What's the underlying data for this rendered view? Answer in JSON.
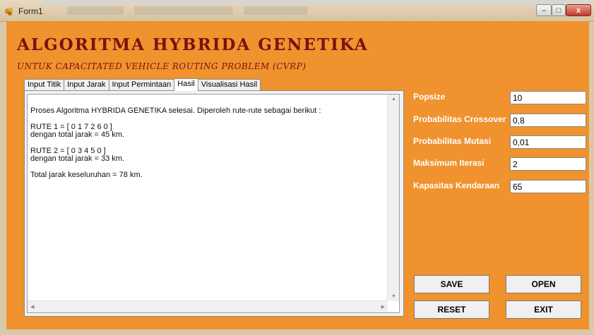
{
  "window": {
    "title": "Form1",
    "minimize": "–",
    "maximize": "□",
    "close": "x"
  },
  "header": {
    "title": "ALGORITMA HYBRIDA GENETIKA",
    "subtitle": "UNTUK CAPACITATED VEHICLE ROUTING PROBLEM (CVRP)"
  },
  "tabs": [
    {
      "label": "Input Titik"
    },
    {
      "label": "Input Jarak"
    },
    {
      "label": "Input Permintaan"
    },
    {
      "label": "Hasil"
    },
    {
      "label": "Visualisasi Hasil"
    }
  ],
  "active_tab": "Hasil",
  "result": {
    "line1": "Proses Algoritma HYBRIDA GENETIKA selesai. Diperoleh rute-rute sebagai berikut :",
    "route1": "RUTE 1 = [  0  1  7  2  6  0  ]",
    "route1_distance": "dengan total jarak = 45 km.",
    "route2": "RUTE 2 = [  0  3  4  5  0  ]",
    "route2_distance": "dengan total jarak = 33 km.",
    "total": "Total jarak keseluruhan = 78 km."
  },
  "params": [
    {
      "label": "Popsize",
      "value": "10"
    },
    {
      "label": "Probabilitas Crossover",
      "value": "0,8"
    },
    {
      "label": "Probabilitas Mutasi",
      "value": "0,01"
    },
    {
      "label": "Maksimum Iterasi",
      "value": "2"
    },
    {
      "label": "Kapasitas Kendaraan",
      "value": "65"
    }
  ],
  "buttons": {
    "save": "SAVE",
    "open": "OPEN",
    "reset": "RESET",
    "exit": "EXIT"
  },
  "colors": {
    "form_bg": "#f0922e",
    "title": "#7b1010",
    "label": "#ffffff"
  }
}
